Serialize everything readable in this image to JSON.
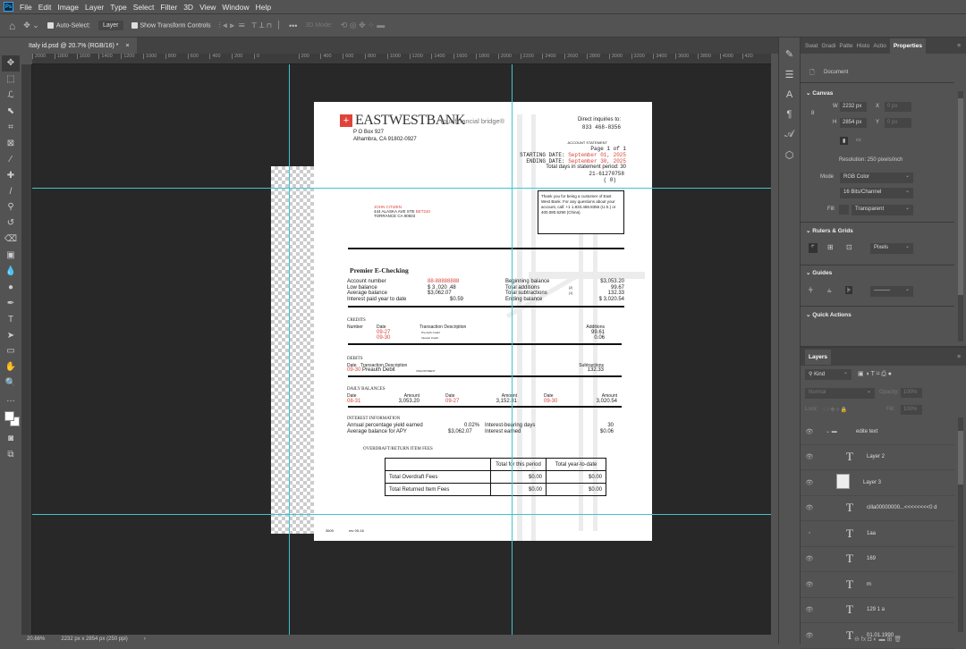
{
  "app": {
    "logo": "Ps",
    "menu": [
      "File",
      "Edit",
      "Image",
      "Layer",
      "Type",
      "Select",
      "Filter",
      "3D",
      "View",
      "Window",
      "Help"
    ]
  },
  "options": {
    "auto_select": "Auto-Select:",
    "auto_select_target": "Layer",
    "show_transform": "Show Transform Controls",
    "more": "•••",
    "mode3d": "3D Mode:"
  },
  "doc_tab": {
    "title": "Italy id.psd @ 20.7% (RGB/16) *",
    "close": "×"
  },
  "ruler_h": [
    "2000",
    "1800",
    "1600",
    "1400",
    "1200",
    "1000",
    "800",
    "600",
    "400",
    "200",
    "0",
    "",
    "200",
    "400",
    "600",
    "800",
    "1000",
    "1200",
    "1400",
    "1600",
    "1800",
    "2000",
    "2200",
    "2400",
    "2600",
    "2800",
    "3000",
    "3200",
    "3400",
    "3600",
    "3800",
    "4000",
    "420"
  ],
  "statusbar": {
    "zoom": "20.66%",
    "dims": "2232 px x 2854 px (250 ppi)",
    "arrow": "›"
  },
  "statement": {
    "bank_name": "EASTWESTBANK",
    "tagline": "Your financial bridge®",
    "bank_addr1": "P O Box 927",
    "bank_addr2": "Alhambra, CA 91802-0927",
    "inquiries_label": "Direct inquiries to:",
    "inquiries_phone": "833 468-8356",
    "acct_stmt": "ACCOUNT STATEMENT",
    "page": "Page  1  of  1",
    "start_label": "STARTING DATE:",
    "start_date": "September 01, 2025",
    "end_label": "ENDING DATE:",
    "end_date": "September 30, 2025",
    "days_label": "Total days in statement period: 30",
    "acct_id": "21-61270758",
    "code": "( 0)",
    "thanks": "Thank you for being a customer of East West Bank. For any questions about your account, call: +1 1.833.468.8356 (U.S.) or 400.080.5290 (China).",
    "cust_name": "JOHN CITIZEN",
    "cust_addr1": "444 ALASKA AVE STE ",
    "cust_addr1_red": "BET240",
    "cust_addr2": "TORRANCE CA 90503",
    "product": "Premier E-Checking",
    "summary_left": [
      {
        "label": "Account number",
        "value": "88-88888888"
      },
      {
        "label": "Low balance",
        "value": "$ 3 ,020  .48"
      },
      {
        "label": "Average balance",
        "value": "$3,062.07"
      },
      {
        "label": "Interest paid year to date",
        "value": "$0.59"
      }
    ],
    "summary_right": [
      {
        "label": "Beginning balance",
        "count": "",
        "value": "$3,053.20"
      },
      {
        "label": "Total additions",
        "count": "(2)",
        "value": "99.67"
      },
      {
        "label": "Total subtractions",
        "count": "(1)",
        "value": "132.33"
      },
      {
        "label": "Ending balance",
        "count": "",
        "value": "$ 3,020.54"
      }
    ],
    "credits": {
      "title": "CREDITS",
      "h_number": "Number",
      "h_date": "Date",
      "h_desc": "Transaction Description",
      "h_add": "Additions",
      "rows": [
        {
          "date": "09-27",
          "desc": "Pre-Auth Credit",
          "amount": "99.61"
        },
        {
          "date": "09-30",
          "desc": "Interest Credit",
          "amount": "0.06"
        }
      ]
    },
    "debits": {
      "title": "DEBITS",
      "h_date": "Date",
      "h_desc": "Transaction Description",
      "h_sub": "Subtractions",
      "rows": [
        {
          "date": "09-30",
          "desc": "Preauth Debit",
          "memo": "VISA PAYMENT",
          "amount": "132.33"
        }
      ]
    },
    "daily": {
      "title": "DAILY BALANCES",
      "h_date": "Date",
      "h_amount": "Amount",
      "rows": [
        {
          "date": "08-31",
          "amount": "3,053.20"
        },
        {
          "date": "09-27",
          "amount": "3,152.81"
        },
        {
          "date": "09-30",
          "amount": "3,020.54"
        }
      ]
    },
    "interest": {
      "title": "INTEREST INFORMATION",
      "apy_label": "Annual percentage yield earned",
      "apy": "0.02%",
      "avg_label": "Average balance for APY",
      "avg": "$3,062.07",
      "days_label": "Interest-bearing days",
      "days": "30",
      "earned_label": "Interest earned",
      "earned": "$0.06"
    },
    "fees": {
      "title": "OVERDRAFT/RETURN ITEM FEES",
      "h_period": "Total for this period",
      "h_ytd": "Total year-to-date",
      "rows": [
        {
          "label": "Total Overdraft Fees",
          "period": "$0.00",
          "ytd": "$0.00"
        },
        {
          "label": "Total Returned Item Fees",
          "period": "$0.00",
          "ytd": "$0.00"
        }
      ]
    },
    "footer_code": "3609",
    "footer_rev": "rev 05-16"
  },
  "properties": {
    "tabs": [
      "Swat",
      "Gradi",
      "Patte",
      "Histo",
      "Actio",
      "Properties"
    ],
    "doc_label": "Document",
    "canvas_title": "Canvas",
    "w_label": "W",
    "w": "2232 px",
    "h_label": "H",
    "h": "2854 px",
    "x_label": "X",
    "x": "0 px",
    "y_label": "Y",
    "y": "0 px",
    "resolution": "Resolution: 250 pixels/inch",
    "mode_label": "Mode",
    "mode": "RGB Color",
    "depth": "16 Bits/Channel",
    "fill_label": "Fill",
    "fill": "Transparent",
    "rulers_title": "Rulers & Grids",
    "units": "Pixels",
    "guides_title": "Guides",
    "quick_title": "Quick Actions"
  },
  "layers": {
    "tab": "Layers",
    "kind": "Kind",
    "blend": "Normal",
    "opacity_label": "Opacity:",
    "opacity": "100%",
    "lock_label": "Lock:",
    "fill_label": "Fill:",
    "fill": "100%",
    "items": [
      {
        "name": "edite text",
        "type": "group"
      },
      {
        "name": "Layer 2",
        "type": "text"
      },
      {
        "name": "Layer 3",
        "type": "pixel"
      },
      {
        "name": "cilla00000000...<<<<<<<<0 d",
        "type": "text"
      },
      {
        "name": "1aa",
        "type": "text",
        "hidden": true
      },
      {
        "name": "169",
        "type": "text"
      },
      {
        "name": "m",
        "type": "text"
      },
      {
        "name": "129 1 a",
        "type": "text"
      },
      {
        "name": "01.01.1990",
        "type": "text"
      }
    ]
  }
}
